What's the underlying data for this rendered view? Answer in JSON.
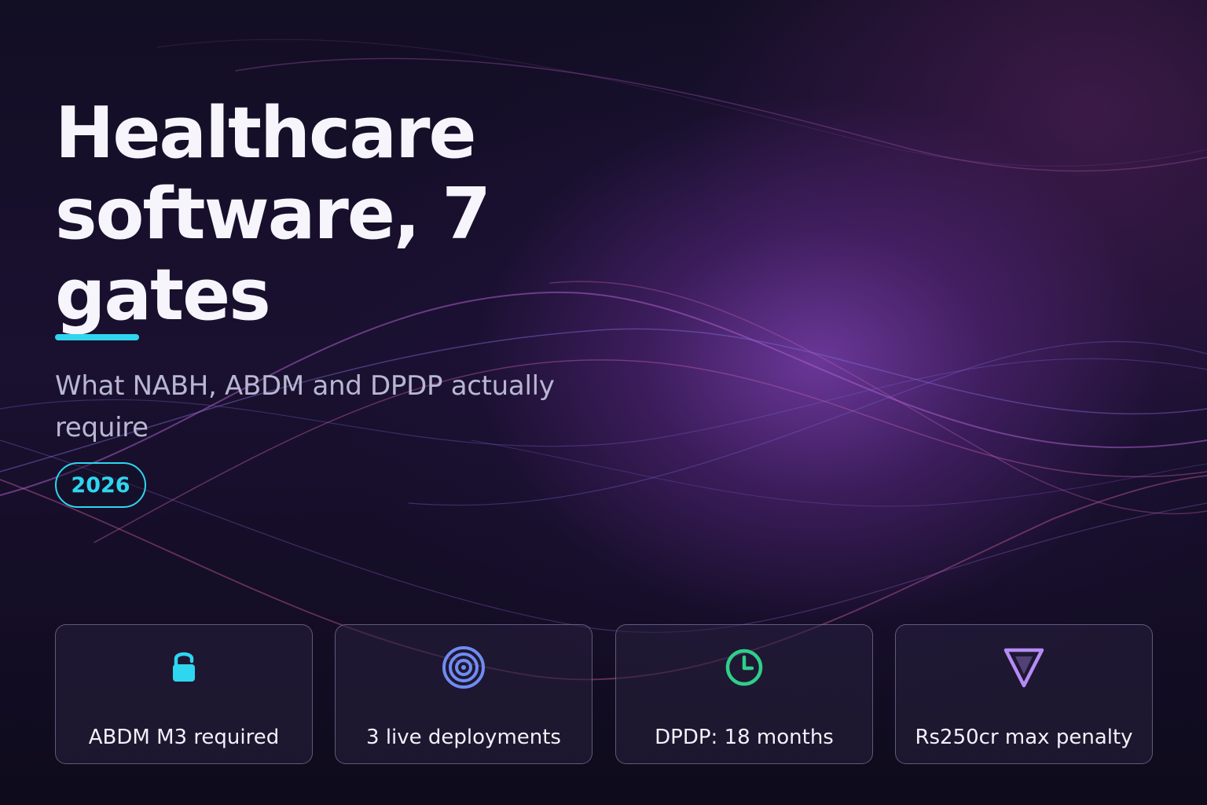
{
  "hero": {
    "headline_lines": [
      "Healthcare",
      "software, 7",
      "gates"
    ],
    "subtitle": "What NABH, ABDM and DPDP actually require",
    "badge": "2026"
  },
  "cards": [
    {
      "icon": "lock-icon",
      "label": "ABDM M3 required",
      "color": "#2fd6ef"
    },
    {
      "icon": "target-icon",
      "label": "3 live deployments",
      "color": "#6f8cf2"
    },
    {
      "icon": "clock-icon",
      "label": "DPDP: 18 months",
      "color": "#2fcf8a"
    },
    {
      "icon": "shield-icon",
      "label": "Rs250cr max penalty",
      "color": "#b58cf5"
    }
  ],
  "colors": {
    "accent": "#2fd6ef",
    "headline": "#f6f5fb",
    "subtitle": "#b8b7d2"
  }
}
